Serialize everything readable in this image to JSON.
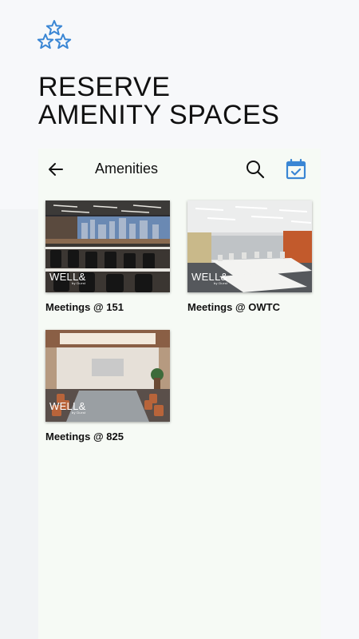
{
  "headline": {
    "line1": "RESERVE",
    "line2": "AMENITY SPACES"
  },
  "icons": {
    "logo": "three-stars-icon",
    "back": "arrow-left-icon",
    "search": "search-icon",
    "calendar": "calendar-check-icon"
  },
  "app": {
    "title": "Amenities"
  },
  "amenities": [
    {
      "label": "Meetings @ 151",
      "brand": "WELL&",
      "brand_sub": "by Durst"
    },
    {
      "label": "Meetings @ OWTC",
      "brand": "WELL&",
      "brand_sub": "by Durst"
    },
    {
      "label": "Meetings @ 825",
      "brand": "WELL&",
      "brand_sub": "by Durst"
    }
  ],
  "colors": {
    "accent": "#3a86d4",
    "panel": "#f6faf5"
  }
}
